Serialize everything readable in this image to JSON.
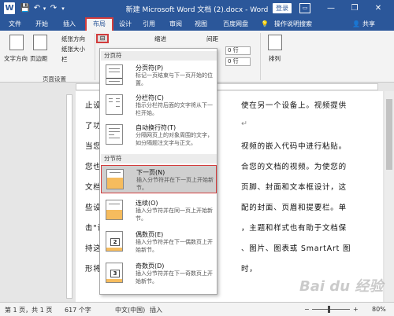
{
  "titlebar": {
    "title": "新建 Microsoft Word 文档 (2).docx  -  Word",
    "login": "登录",
    "app_icon": "W",
    "save_icon": "💾",
    "undo_icon": "↶",
    "redo_icon": "↷",
    "dropdown": "▾",
    "ribbon_options": "▭",
    "minimize": "—",
    "restore": "❐",
    "close": "✕"
  },
  "tabs": {
    "file": "文件",
    "home": "开始",
    "insert": "插入",
    "layout": "布局",
    "design": "设计",
    "references": "引用",
    "review": "审阅",
    "view": "视图",
    "baidu": "百度网盘",
    "tell_me": "操作说明搜索",
    "tell_me_icon": "💡",
    "share": "共享",
    "share_icon": "👤"
  },
  "ribbon": {
    "text_direction": "文字方向",
    "margins": "页边距",
    "orientation": "纸张方向",
    "size": "纸张大小",
    "columns": "栏",
    "breaks_icon": "⊟",
    "indent": "缩进",
    "spacing": "间距",
    "before_value": "0 行",
    "after_value": "0 行",
    "arrange": "排列",
    "page_setup_group": "页面设置"
  },
  "document": {
    "lines": [
      "止设",
      "了功",
      "当您",
      "您也",
      "文档",
      "些设",
      "击\"设",
      "持这",
      "形将"
    ],
    "right_lines": [
      "使在另一个设备上。视频提供",
      "↵",
      "视频的嵌入代码中进行粘贴。",
      "合您的文档的视频。为使您的",
      "页脚、封面和文本框设计，这",
      "配的封面、页眉和提要栏。单",
      "，主题和样式也有助于文档保",
      "、图片、图表或 SmartArt 图",
      "时，"
    ]
  },
  "menu": {
    "section_page": "分页符",
    "section_section": "分节符",
    "items": [
      {
        "title": "分页符(P)",
        "desc": "标记一页结束与下一页开始的位置。"
      },
      {
        "title": "分栏符(C)",
        "desc": "指示分栏符后面的文字将从下一栏开始。"
      },
      {
        "title": "自动换行符(T)",
        "desc": "分隔网页上的对象周围的文字，如分隔题注文字与正文。"
      },
      {
        "title": "下一页(N)",
        "desc": "插入分节符并在下一页上开始新节。"
      },
      {
        "title": "连续(O)",
        "desc": "插入分节符并在同一页上开始新节。"
      },
      {
        "title": "偶数页(E)",
        "desc": "插入分节符并在下一偶数页上开始新节。",
        "num": "2"
      },
      {
        "title": "奇数页(D)",
        "desc": "插入分节符并在下一奇数页上开始新节。",
        "num": "3"
      }
    ]
  },
  "statusbar": {
    "page": "第 1 页，共 1 页",
    "words": "617 个字",
    "language": "中文(中国)",
    "insert": "插入",
    "zoom_minus": "−",
    "zoom_plus": "+",
    "zoom": "80%"
  },
  "watermark": "Bai du 经验",
  "colors": {
    "brand": "#2b579a",
    "highlight_border": "#d23c3c"
  }
}
